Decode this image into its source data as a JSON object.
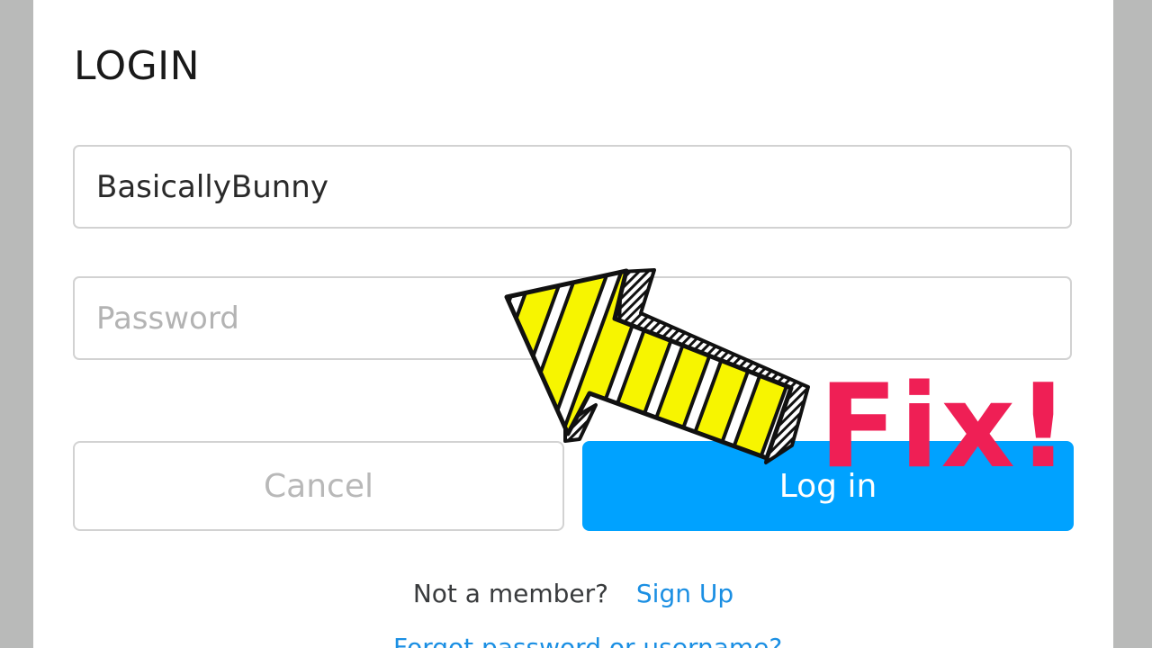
{
  "dialog": {
    "title": "LOGIN",
    "username": {
      "value": "BasicallyBunny"
    },
    "password": {
      "placeholder": "Password"
    },
    "buttons": {
      "cancel": "Cancel",
      "login": "Log in"
    },
    "signup": {
      "prompt": "Not a member?",
      "link": "Sign Up"
    },
    "forgot_link": "Forgot password or username?"
  },
  "overlay": {
    "text": "Fix!",
    "arrow_icon": "striped-arrow-icon"
  },
  "colors": {
    "accent": "#00a2ff",
    "link": "#1b8fe3",
    "overlay_text": "#ef1f55",
    "arrow_fill": "#f7f500",
    "background": "#b9bab9"
  }
}
